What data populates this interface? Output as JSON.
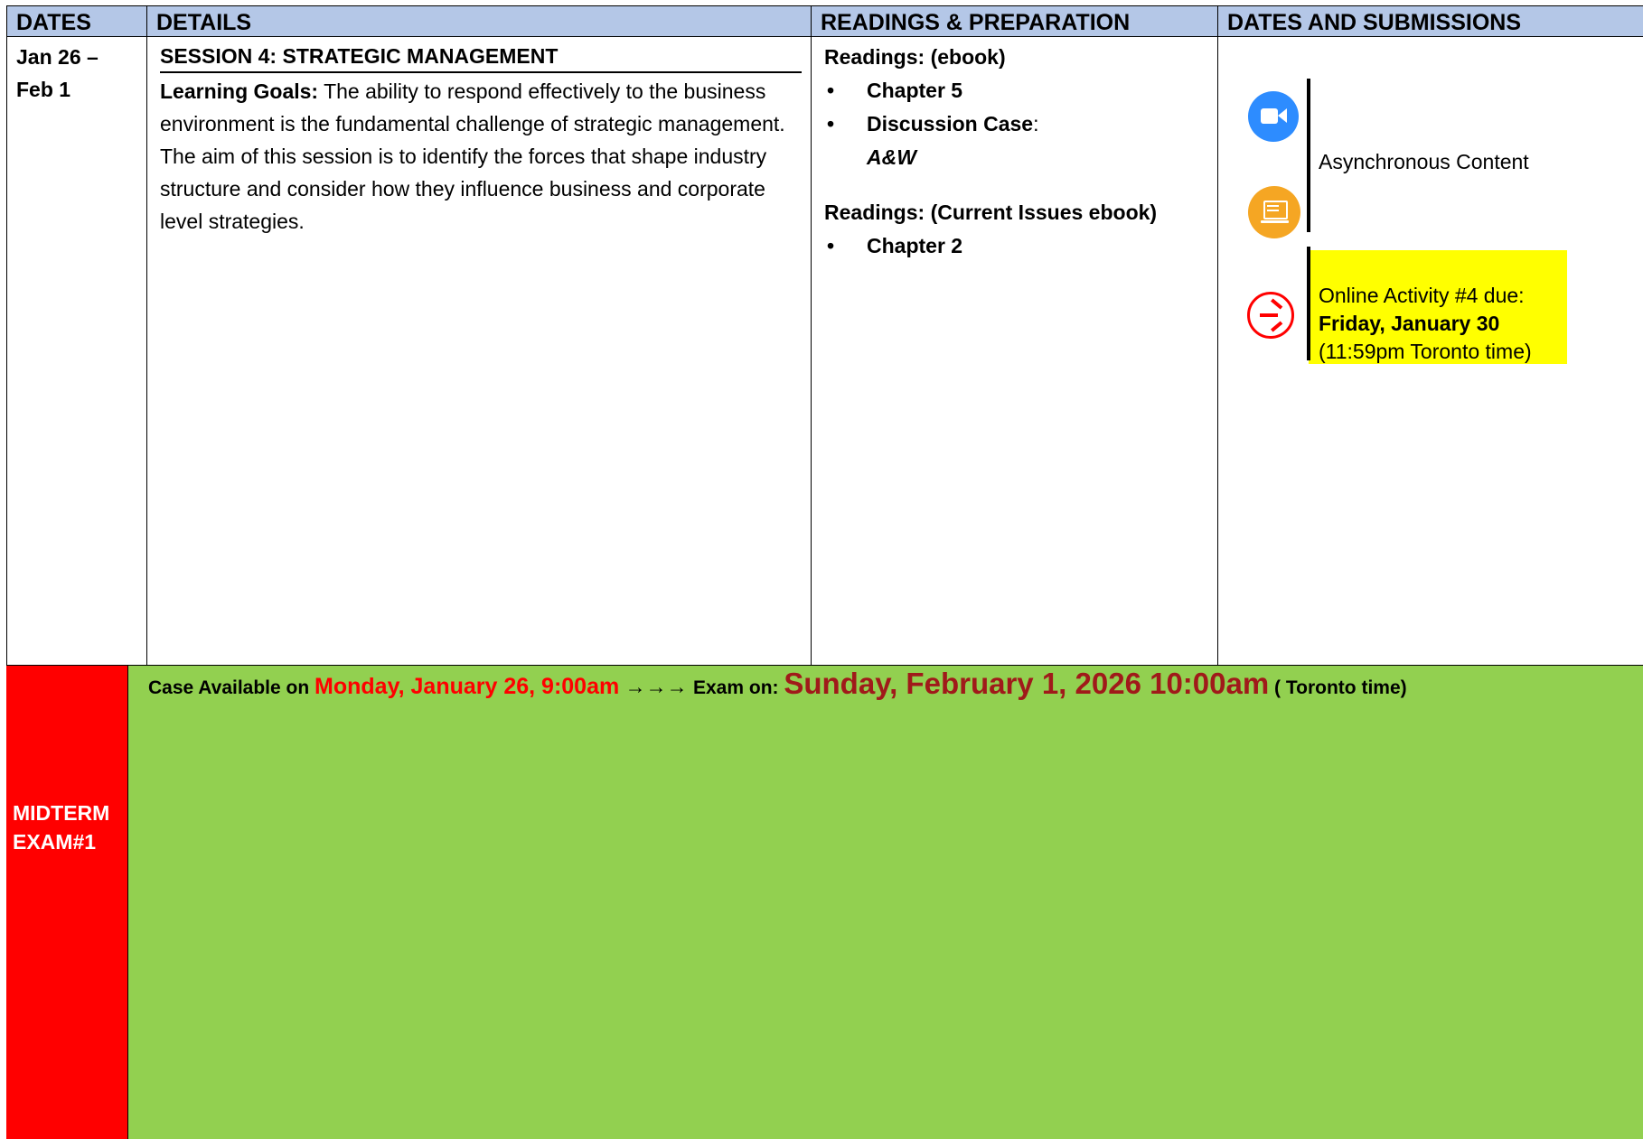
{
  "header": {
    "col_dates": "DATES",
    "col_details": "DETAILS",
    "col_readings": "READINGS & PREPARATION",
    "col_submissions": "DATES AND SUBMISSIONS"
  },
  "session": {
    "dates_line1": "Jan 26 –",
    "dates_line2": "Feb 1",
    "title": "SESSION 4: STRATEGIC MANAGEMENT",
    "goals_label": "Learning Goals:",
    "goals_text": " The ability to respond effectively to the business environment is the fundamental challenge of strategic management. The aim of this session is to identify the forces that shape industry structure and consider how they influence business and corporate level strategies."
  },
  "readings": {
    "head1": "Readings: (ebook)",
    "item1": "Chapter 5",
    "item2_label": "Discussion Case",
    "item2_colon": ":",
    "item2_case": "A&W",
    "head2": "Readings: (Current Issues ebook)",
    "item3": "Chapter 2"
  },
  "submissions": {
    "icons": [
      "video-camera-icon",
      "presentation-screen-icon",
      "arrow-right-circle-icon"
    ],
    "async_label": "Asynchronous Content",
    "due_line1": "Online Activity #4 due:",
    "due_line2": "Friday, January 30",
    "due_line3": "(11:59pm Toronto time)",
    "highlight_color": "#ffff00"
  },
  "midterm": {
    "label_line1": "MIDTERM",
    "label_line2": "EXAM#1",
    "available_prefix": "Case Available on ",
    "available_date": "Monday, January 26, 9:00am",
    "arrows": "  →→→  ",
    "exam_prefix": "Exam on: ",
    "exam_date": "Sunday, February 1, 2026  10:00am",
    "exam_suffix": "  ( Toronto time)",
    "left_color": "#ff0000",
    "right_color": "#92d050"
  }
}
